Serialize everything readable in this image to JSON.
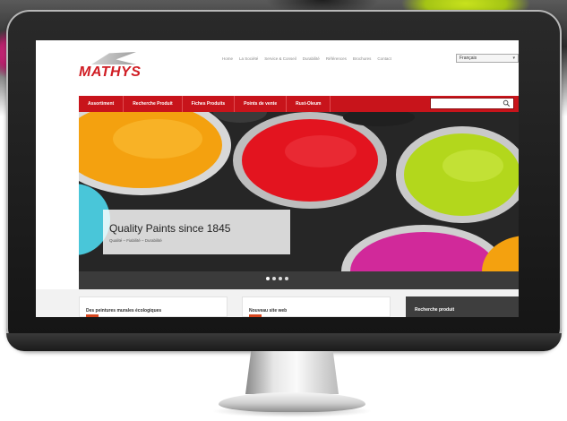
{
  "website": {
    "brand": "MATHYS",
    "top_nav": [
      "Home",
      "La Société",
      "Service & Conseil",
      "Durabilité",
      "Références",
      "Brochures",
      "Contact"
    ],
    "language": "Français",
    "main_nav": [
      "Assortiment",
      "Recherche Produit",
      "Fiches Produits",
      "Points de vente",
      "Rust-Oleum"
    ],
    "search": {
      "placeholder": ""
    },
    "hero": {
      "title": "Quality Paints since 1845",
      "subtitle": "Qualité – Fiabilité – Durabilité"
    },
    "cards": [
      {
        "title": "Des peintures murales écologiques"
      },
      {
        "title": "Nouveau site web"
      }
    ],
    "search_panel_title": "Recherche produit",
    "slider": {
      "count": 4,
      "active_index": 0
    }
  },
  "colors": {
    "brand_red": "#c8141b",
    "paint_orange": "#f4a10f",
    "paint_red": "#e3141f",
    "paint_lime": "#b3d71c",
    "paint_magenta": "#d1299a",
    "paint_cyan": "#49c6d9"
  }
}
